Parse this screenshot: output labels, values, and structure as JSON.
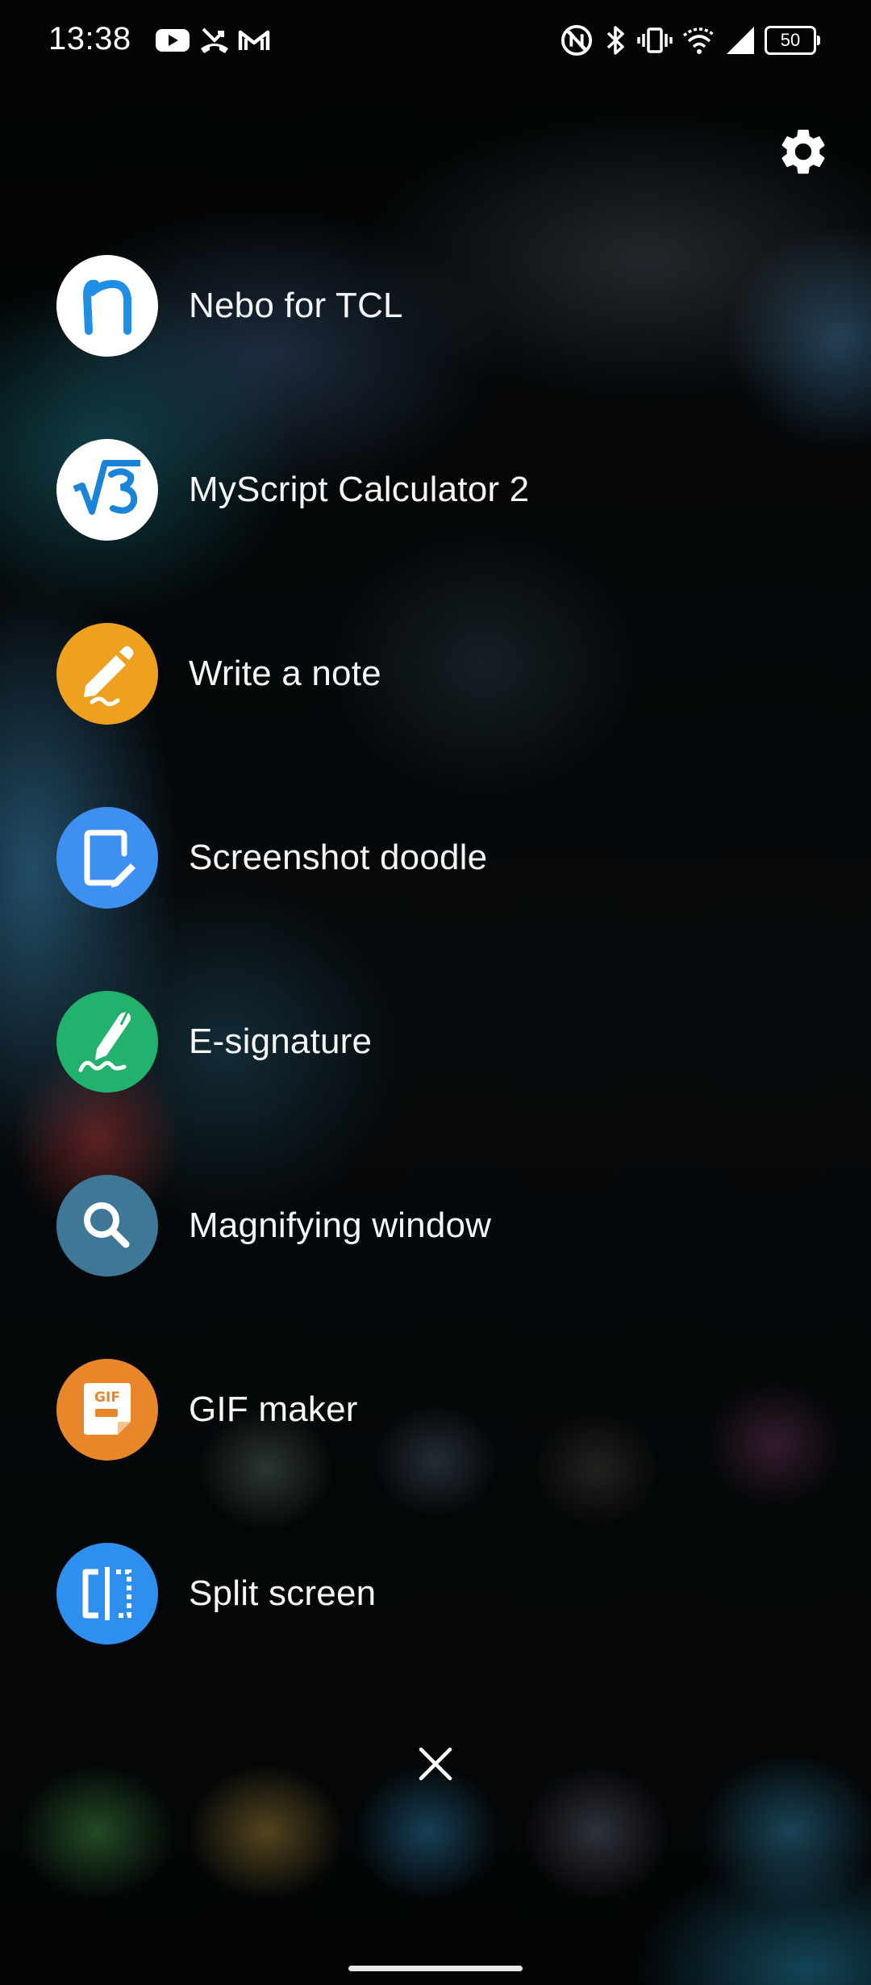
{
  "status_bar": {
    "time": "13:38",
    "battery_level": "50",
    "notification_icons": [
      "youtube-icon",
      "missed-call-icon",
      "gmail-icon"
    ],
    "system_icons": [
      "nfc-icon",
      "bluetooth-icon",
      "vibrate-icon",
      "wifi-icon",
      "cellular-signal-icon",
      "battery-icon"
    ]
  },
  "toolbar": {
    "settings_icon": "gear-icon",
    "close_icon": "close-icon"
  },
  "tools": [
    {
      "label": "Nebo for TCL",
      "icon": "nebo-icon",
      "color": "#ffffff"
    },
    {
      "label": "MyScript Calculator 2",
      "icon": "myscript-calculator-icon",
      "color": "#ffffff"
    },
    {
      "label": "Write a note",
      "icon": "write-note-icon",
      "color": "#eea11f"
    },
    {
      "label": "Screenshot doodle",
      "icon": "screenshot-doodle-icon",
      "color": "#3d8ff0"
    },
    {
      "label": "E-signature",
      "icon": "e-signature-icon",
      "color": "#23b26d"
    },
    {
      "label": "Magnifying window",
      "icon": "magnifier-icon",
      "color": "#3f7796"
    },
    {
      "label": "GIF maker",
      "icon": "gif-maker-icon",
      "color": "#e8872a"
    },
    {
      "label": "Split screen",
      "icon": "split-screen-icon",
      "color": "#2f8ff0"
    }
  ],
  "gif_icon_text": "GIF"
}
